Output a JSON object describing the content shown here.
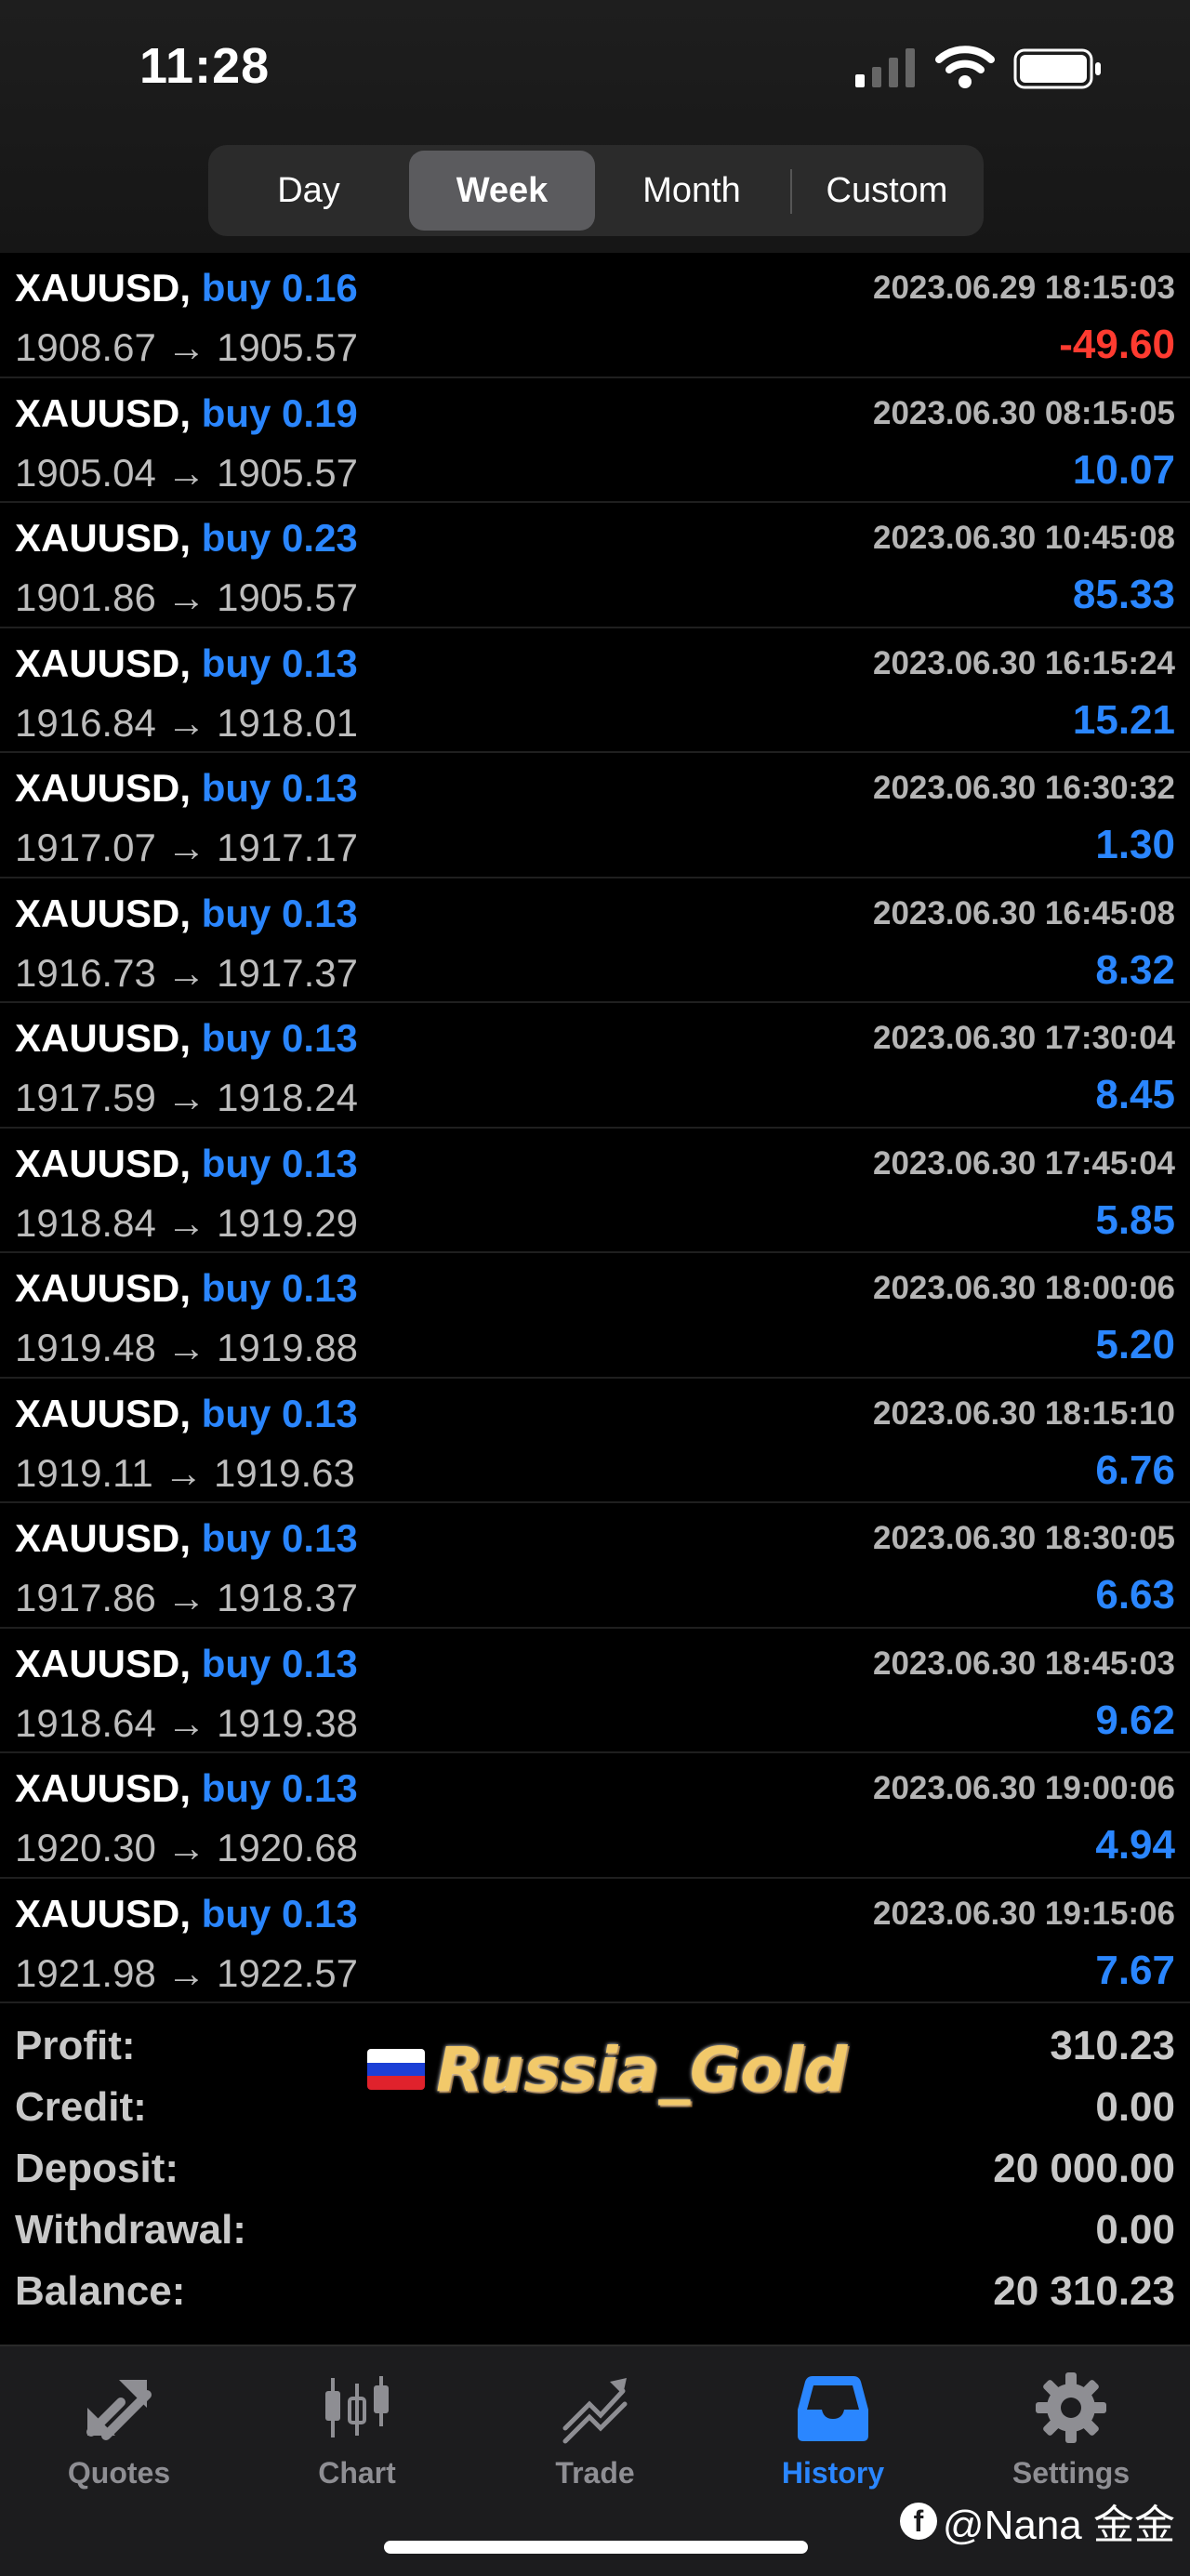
{
  "status_bar": {
    "time": "11:28"
  },
  "period_tabs": [
    {
      "label": "Day",
      "active": false
    },
    {
      "label": "Week",
      "active": true
    },
    {
      "label": "Month",
      "active": false
    },
    {
      "label": "Custom",
      "active": false
    }
  ],
  "trades": [
    {
      "symbol": "XAUUSD,",
      "action": "buy 0.16",
      "open": "1908.67",
      "arrow": "→",
      "close": "1905.57",
      "time": "2023.06.29 18:15:03",
      "profit": "-49.60",
      "negative": true
    },
    {
      "symbol": "XAUUSD,",
      "action": "buy 0.19",
      "open": "1905.04",
      "arrow": "→",
      "close": "1905.57",
      "time": "2023.06.30 08:15:05",
      "profit": "10.07",
      "negative": false
    },
    {
      "symbol": "XAUUSD,",
      "action": "buy 0.23",
      "open": "1901.86",
      "arrow": "→",
      "close": "1905.57",
      "time": "2023.06.30 10:45:08",
      "profit": "85.33",
      "negative": false
    },
    {
      "symbol": "XAUUSD,",
      "action": "buy 0.13",
      "open": "1916.84",
      "arrow": "→",
      "close": "1918.01",
      "time": "2023.06.30 16:15:24",
      "profit": "15.21",
      "negative": false
    },
    {
      "symbol": "XAUUSD,",
      "action": "buy 0.13",
      "open": "1917.07",
      "arrow": "→",
      "close": "1917.17",
      "time": "2023.06.30 16:30:32",
      "profit": "1.30",
      "negative": false
    },
    {
      "symbol": "XAUUSD,",
      "action": "buy 0.13",
      "open": "1916.73",
      "arrow": "→",
      "close": "1917.37",
      "time": "2023.06.30 16:45:08",
      "profit": "8.32",
      "negative": false
    },
    {
      "symbol": "XAUUSD,",
      "action": "buy 0.13",
      "open": "1917.59",
      "arrow": "→",
      "close": "1918.24",
      "time": "2023.06.30 17:30:04",
      "profit": "8.45",
      "negative": false
    },
    {
      "symbol": "XAUUSD,",
      "action": "buy 0.13",
      "open": "1918.84",
      "arrow": "→",
      "close": "1919.29",
      "time": "2023.06.30 17:45:04",
      "profit": "5.85",
      "negative": false
    },
    {
      "symbol": "XAUUSD,",
      "action": "buy 0.13",
      "open": "1919.48",
      "arrow": "→",
      "close": "1919.88",
      "time": "2023.06.30 18:00:06",
      "profit": "5.20",
      "negative": false
    },
    {
      "symbol": "XAUUSD,",
      "action": "buy 0.13",
      "open": "1919.11",
      "arrow": "→",
      "close": "1919.63",
      "time": "2023.06.30 18:15:10",
      "profit": "6.76",
      "negative": false
    },
    {
      "symbol": "XAUUSD,",
      "action": "buy 0.13",
      "open": "1917.86",
      "arrow": "→",
      "close": "1918.37",
      "time": "2023.06.30 18:30:05",
      "profit": "6.63",
      "negative": false
    },
    {
      "symbol": "XAUUSD,",
      "action": "buy 0.13",
      "open": "1918.64",
      "arrow": "→",
      "close": "1919.38",
      "time": "2023.06.30 18:45:03",
      "profit": "9.62",
      "negative": false
    },
    {
      "symbol": "XAUUSD,",
      "action": "buy 0.13",
      "open": "1920.30",
      "arrow": "→",
      "close": "1920.68",
      "time": "2023.06.30 19:00:06",
      "profit": "4.94",
      "negative": false
    },
    {
      "symbol": "XAUUSD,",
      "action": "buy 0.13",
      "open": "1921.98",
      "arrow": "→",
      "close": "1922.57",
      "time": "2023.06.30 19:15:06",
      "profit": "7.67",
      "negative": false
    }
  ],
  "summary": {
    "profit_label": "Profit:",
    "profit": "310.23",
    "credit_label": "Credit:",
    "credit": "0.00",
    "deposit_label": "Deposit:",
    "deposit": "20 000.00",
    "withdrawal_label": "Withdrawal:",
    "withdrawal": "0.00",
    "balance_label": "Balance:",
    "balance": "20 310.23"
  },
  "watermark": {
    "text": "Russia_Gold",
    "flag_icon": "russia-flag-icon"
  },
  "tab_bar": [
    {
      "label": "Quotes",
      "icon": "quotes-icon",
      "active": false
    },
    {
      "label": "Chart",
      "icon": "candlestick-icon",
      "active": false
    },
    {
      "label": "Trade",
      "icon": "trade-icon",
      "active": false
    },
    {
      "label": "History",
      "icon": "history-inbox-icon",
      "active": true
    },
    {
      "label": "Settings",
      "icon": "gear-icon",
      "active": false
    }
  ],
  "credit": {
    "text": "@Nana 金金",
    "icon": "facebook-icon"
  },
  "colors": {
    "accent": "#2a86ff",
    "loss": "#ff3b30",
    "background": "#000000"
  }
}
